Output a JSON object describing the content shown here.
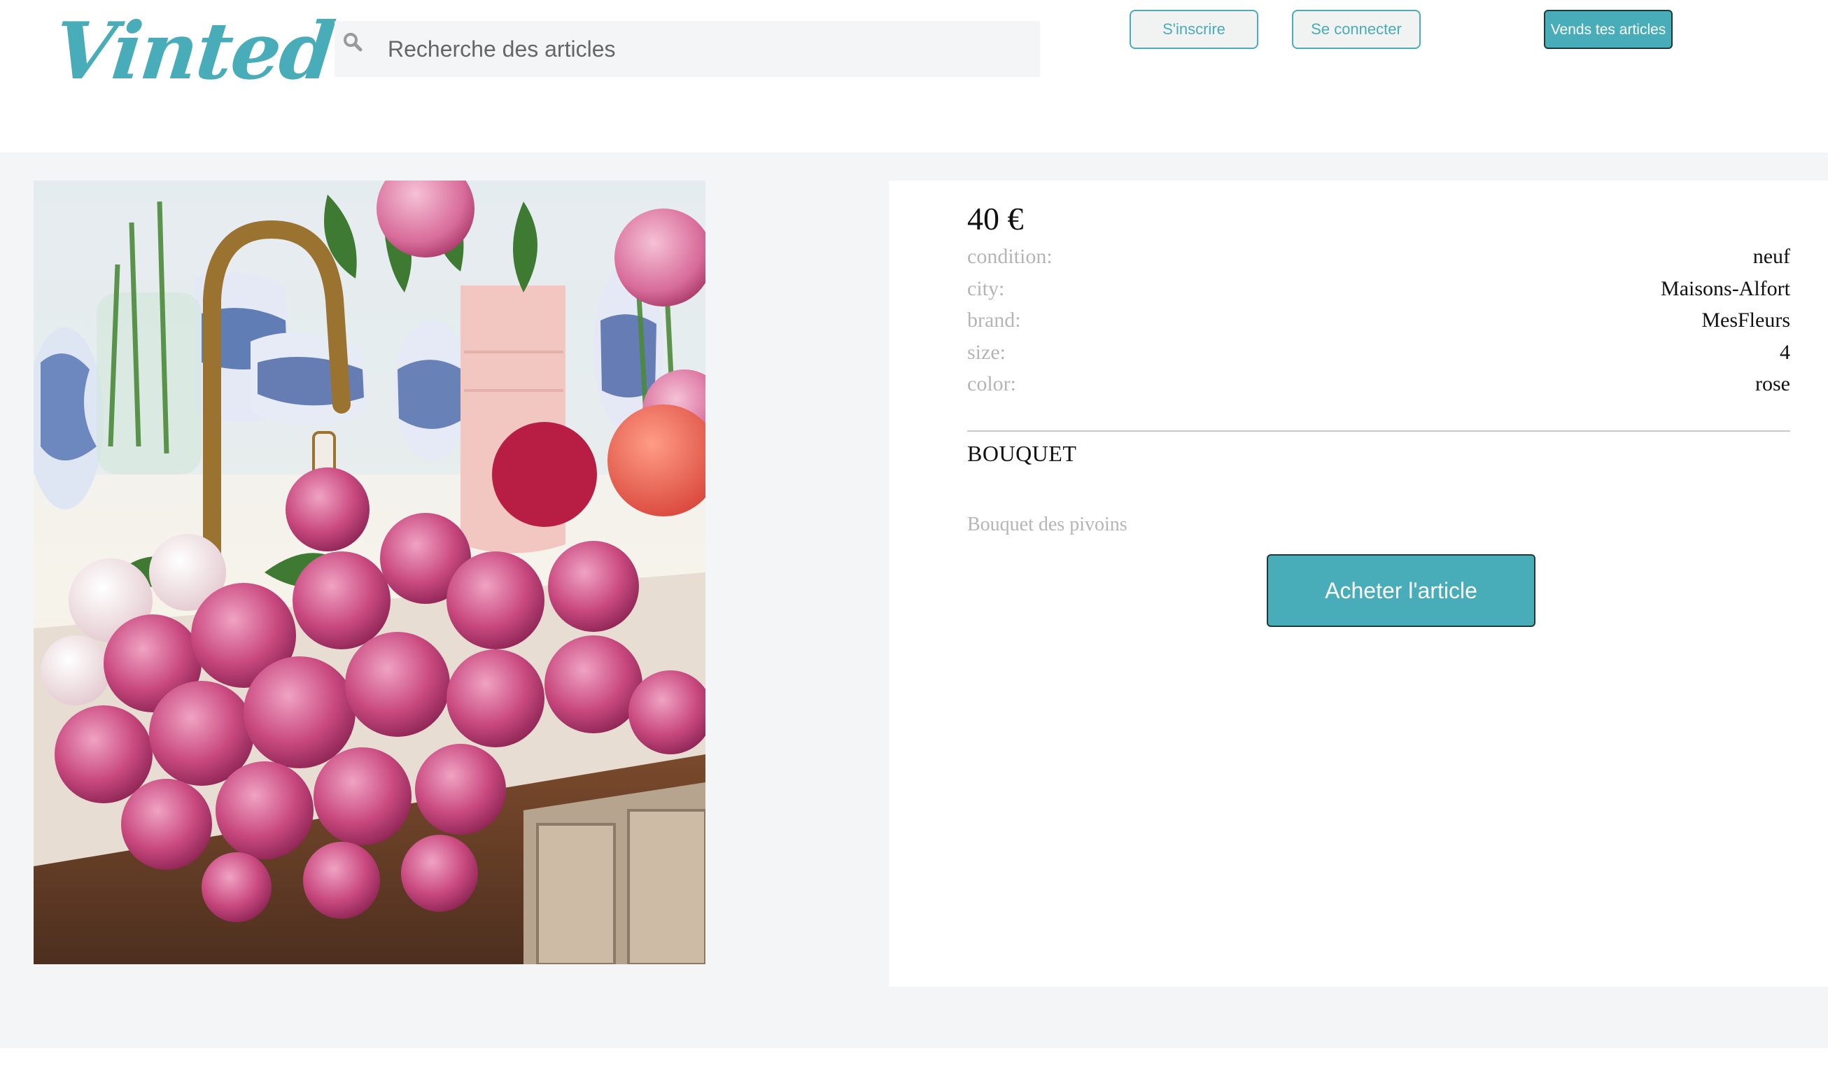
{
  "header": {
    "logo_text": "Vinted",
    "search": {
      "placeholder": "Recherche des articles",
      "value": ""
    },
    "signup_label": "S'inscrire",
    "login_label": "Se connecter",
    "sell_label": "Vends tes articles"
  },
  "item": {
    "price": "40 €",
    "details": [
      {
        "key": "condition:",
        "value": "neuf"
      },
      {
        "key": "city:",
        "value": "Maisons-Alfort"
      },
      {
        "key": "brand:",
        "value": "MesFleurs"
      },
      {
        "key": "size:",
        "value": "4"
      },
      {
        "key": "color:",
        "value": "rose"
      }
    ],
    "title": "BOUQUET",
    "description": "Bouquet des pivoins",
    "buy_label": "Acheter l'article"
  },
  "colors": {
    "accent": "#48adb8",
    "page_bg": "#f4f5f7",
    "muted_text": "#b5b5b5"
  }
}
